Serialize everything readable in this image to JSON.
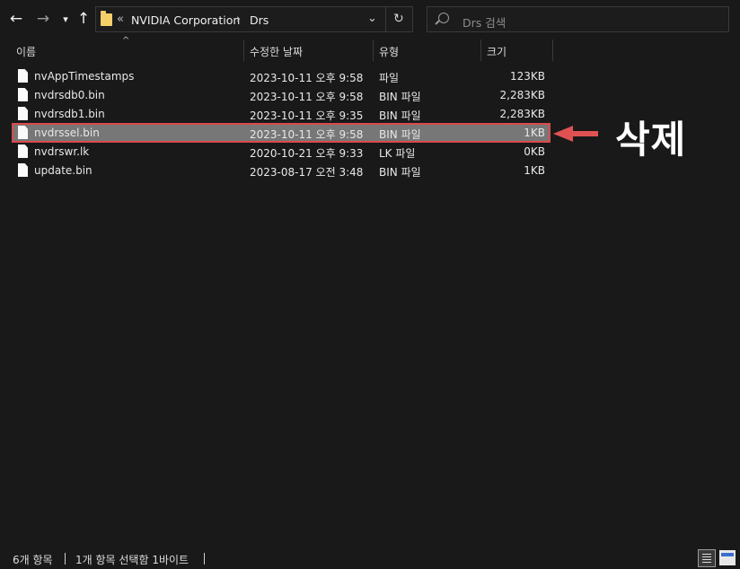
{
  "toolbar": {
    "back_icon": "arrow-left-icon",
    "forward_icon": "arrow-right-icon",
    "recent_icon": "chevron-down-icon",
    "up_icon": "arrow-up-icon",
    "address": {
      "overflow": "«",
      "crumb1": "NVIDIA Corporation",
      "sep": "›",
      "crumb2": "Drs",
      "dropdown": "⌄",
      "refresh": "↻"
    },
    "search_placeholder": "Drs 검색"
  },
  "columns": {
    "name": "이름",
    "date": "수정한 날짜",
    "type": "유형",
    "size": "크기"
  },
  "files": [
    {
      "name": "nvAppTimestamps",
      "date": "2023-10-11 오후 9:58",
      "type": "파일",
      "size": "123KB"
    },
    {
      "name": "nvdrsdb0.bin",
      "date": "2023-10-11 오후 9:58",
      "type": "BIN 파일",
      "size": "2,283KB"
    },
    {
      "name": "nvdrsdb1.bin",
      "date": "2023-10-11 오후 9:35",
      "type": "BIN 파일",
      "size": "2,283KB"
    },
    {
      "name": "nvdrssel.bin",
      "date": "2023-10-11 오후 9:58",
      "type": "BIN 파일",
      "size": "1KB",
      "selected": true
    },
    {
      "name": "nvdrswr.lk",
      "date": "2020-10-21 오후 9:33",
      "type": "LK 파일",
      "size": "0KB"
    },
    {
      "name": "update.bin",
      "date": "2023-08-17 오전 3:48",
      "type": "BIN 파일",
      "size": "1KB"
    }
  ],
  "annotation": {
    "text": "삭제",
    "color": "#e05252"
  },
  "status": {
    "count": "6개 항목",
    "selection": "1개 항목 선택함 1바이트"
  },
  "colors": {
    "background": "#191919",
    "selected_row": "#777777",
    "highlight_border": "#d94b4b"
  }
}
